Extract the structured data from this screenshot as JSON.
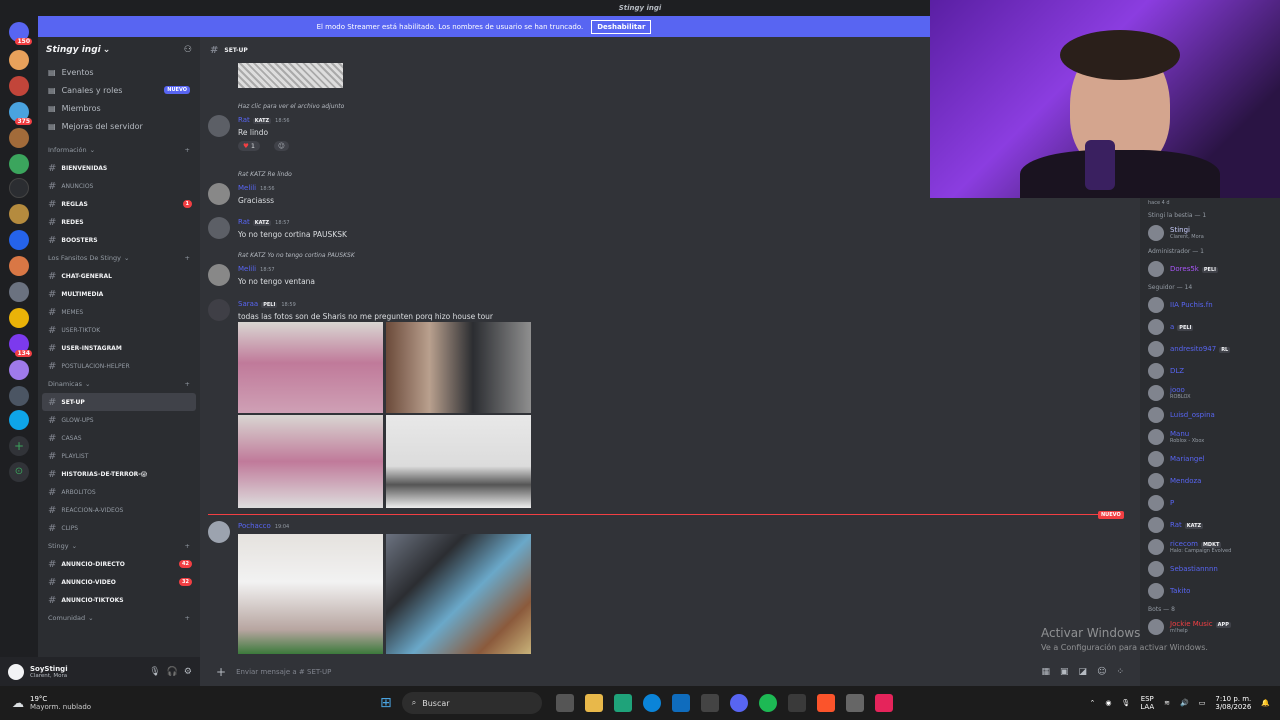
{
  "window": {
    "title": "Stingy ingi"
  },
  "banner": {
    "text": "El modo Streamer está habilitado. Los nombres de usuario se han truncado.",
    "button": "Deshabilitar"
  },
  "guild_badges": [
    "150",
    "375",
    "134"
  ],
  "server": {
    "name": "Stingy ingi",
    "menu": [
      {
        "label": "Eventos",
        "icon": "calendar-icon"
      },
      {
        "label": "Canales y roles",
        "icon": "list-icon",
        "badge": "NUEVO"
      },
      {
        "label": "Miembros",
        "icon": "people-icon"
      },
      {
        "label": "Mejoras del servidor",
        "icon": "boost-icon"
      }
    ]
  },
  "categories": [
    {
      "name": "Información",
      "channels": [
        {
          "name": "BIENVENIDAS",
          "bold": true
        },
        {
          "name": "ANUNCIOS",
          "bold": false
        },
        {
          "name": "REGLAS",
          "bold": true,
          "count": "1"
        },
        {
          "name": "REDES",
          "bold": true
        },
        {
          "name": "BOOSTERS",
          "bold": true
        }
      ]
    },
    {
      "name": "Los Fansitos De Stingy",
      "channels": [
        {
          "name": "CHAT-GENERAL",
          "bold": true
        },
        {
          "name": "MULTIMEDIA",
          "bold": true
        },
        {
          "name": "MEMES",
          "bold": false
        },
        {
          "name": "USER-TIKTOK",
          "bold": false
        },
        {
          "name": "USER-INSTAGRAM",
          "bold": true
        },
        {
          "name": "POSTULACION-HELPER",
          "bold": false
        }
      ]
    },
    {
      "name": "Dinamicas",
      "channels": [
        {
          "name": "SET-UP",
          "bold": true,
          "active": true
        },
        {
          "name": "GLOW-UPS",
          "bold": false
        },
        {
          "name": "CASAS",
          "bold": false
        },
        {
          "name": "PLAYLIST",
          "bold": false
        },
        {
          "name": "historias-de-terror-😱",
          "bold": true
        },
        {
          "name": "ARBOLITOS",
          "bold": false
        },
        {
          "name": "REACCION-A-VIDEOS",
          "bold": false
        },
        {
          "name": "CLIPS",
          "bold": false
        }
      ]
    },
    {
      "name": "Stingy",
      "channels": [
        {
          "name": "ANUNCIO-DIRECTO",
          "bold": true,
          "count": "42"
        },
        {
          "name": "ANUNCIO-VIDEO",
          "bold": true,
          "count": "32"
        },
        {
          "name": "ANUNCIO-TIKTOKS",
          "bold": true
        }
      ]
    },
    {
      "name": "Comunidad",
      "channels": []
    }
  ],
  "user": {
    "name": "SoyStingi",
    "status": "Clarent, Mora"
  },
  "channel": {
    "name": "SET-UP"
  },
  "messages": {
    "m1": {
      "reply": "Haz clic para ver el archivo adjunto",
      "author": "Rat",
      "tag": "KATZ",
      "time": "18:56",
      "text": "Re lindo",
      "reaction_count": "1"
    },
    "m2": {
      "reply_author": "Rat",
      "reply_tag": "KATZ",
      "reply": "Re lindo",
      "author": "Melili",
      "time": "18:56",
      "text": "Graciasss"
    },
    "m3": {
      "author": "Rat",
      "tag": "KATZ",
      "time": "18:57",
      "text": "Yo no tengo cortina PAUSKSK"
    },
    "m4": {
      "reply_author": "Rat",
      "reply_tag": "KATZ",
      "reply": "Yo no tengo cortina PAUSKSK",
      "author": "Melili",
      "time": "18:57",
      "text": "Yo no tengo ventana"
    },
    "m5": {
      "author": "Saraa",
      "tag": "PELI",
      "time": "18:59",
      "text": "todas las fotos son de Sharis no me pregunten porq hizo house tour"
    },
    "m6": {
      "author": "Pochacco",
      "time": "19:04"
    }
  },
  "new_divider": "NUEVO",
  "composer": {
    "placeholder": "Enviar mensaje a #",
    "channel": "SET-UP"
  },
  "members": {
    "top_note": "hace 4 d",
    "groups": [
      {
        "header": "Stingi la bestia — 1",
        "items": [
          {
            "name": "Stingi",
            "sub": "Clarent, Mora",
            "color": "#c9cdfb"
          }
        ]
      },
      {
        "header": "Administrador — 1",
        "items": [
          {
            "name": "Dores5k",
            "sub": "",
            "tag": "PELI",
            "color": "#a855f7"
          }
        ]
      },
      {
        "header": "Seguidor — 14",
        "items": [
          {
            "name": "IIA Puchis.fn",
            "sub": "",
            "color": "#5865f2"
          },
          {
            "name": "a",
            "sub": "",
            "tag": "PELI",
            "color": "#5865f2"
          },
          {
            "name": "andresito947",
            "sub": "",
            "tag": "RL",
            "color": "#5865f2"
          },
          {
            "name": "DLZ",
            "sub": "",
            "color": "#5865f2"
          },
          {
            "name": "jooo",
            "sub": "ROBLOX",
            "color": "#5865f2"
          },
          {
            "name": "Luisd_ospina",
            "sub": "",
            "color": "#5865f2"
          },
          {
            "name": "Manu",
            "sub": "Roblox - Xbox",
            "color": "#5865f2"
          },
          {
            "name": "Mariangel",
            "sub": "",
            "color": "#5865f2"
          },
          {
            "name": "Mendoza",
            "sub": "",
            "color": "#5865f2"
          },
          {
            "name": "P",
            "sub": "",
            "color": "#5865f2"
          },
          {
            "name": "Rat",
            "sub": "",
            "tag": "KATZ",
            "color": "#5865f2"
          },
          {
            "name": "ricecom",
            "sub": "Halo: Campaign Evolved",
            "tag": "MDKT",
            "color": "#5865f2"
          },
          {
            "name": "Sebastiannnn",
            "sub": "",
            "color": "#5865f2"
          },
          {
            "name": "Takito",
            "sub": "",
            "color": "#5865f2"
          }
        ]
      },
      {
        "header": "Bots — 8",
        "items": [
          {
            "name": "Jockie Music",
            "sub": "m!help",
            "tag": "APP",
            "color": "#f23f43"
          }
        ]
      }
    ]
  },
  "watermark": {
    "title": "Activar Windows",
    "sub": "Ve a Configuración para activar Windows."
  },
  "taskbar": {
    "weather_temp": "19°C",
    "weather_desc": "Mayorm. nublado",
    "search": "Buscar",
    "lang": "ESP",
    "region": "LAA",
    "time": "7:10 p. m.",
    "date": "3/08/2026"
  }
}
